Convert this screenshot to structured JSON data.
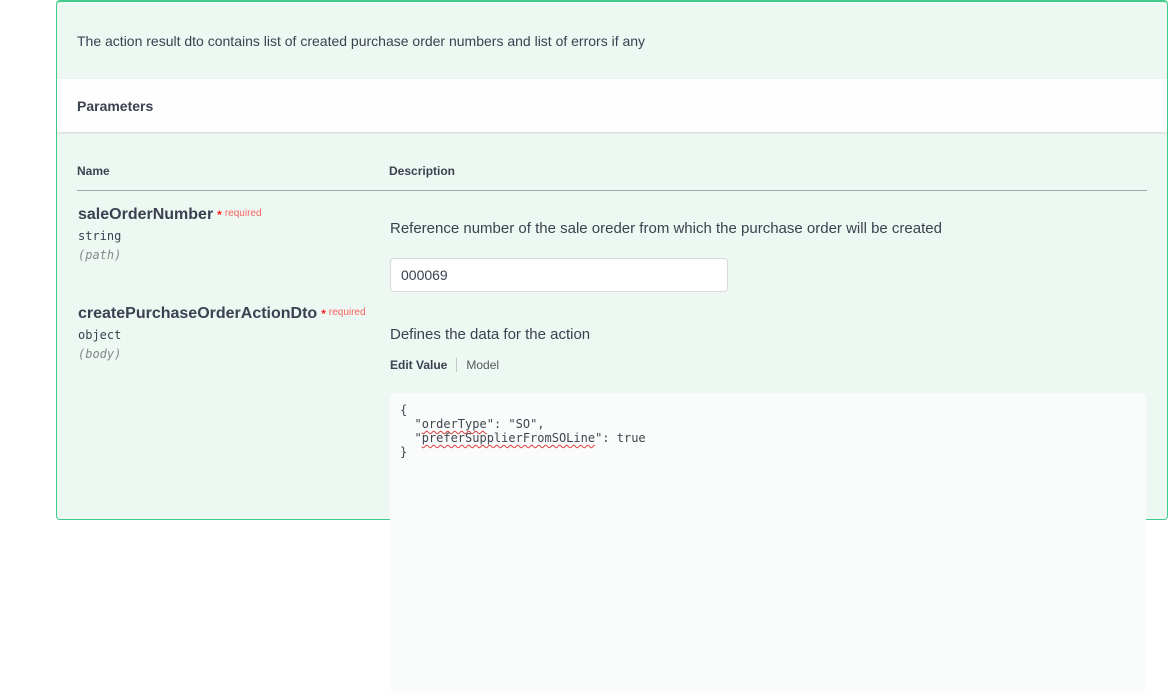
{
  "colors": {
    "accent_green": "#41ca8e",
    "block_background": "#edf8f2",
    "required_red": "#ff2020",
    "text": "#3b4151"
  },
  "opblock": {
    "description": "The action result dto contains list of created purchase order numbers and list of errors if any",
    "parameters_title": "Parameters"
  },
  "table": {
    "name_header": "Name",
    "description_header": "Description"
  },
  "parameters": [
    {
      "name": "saleOrderNumber",
      "required_star": "*",
      "required_label": "required",
      "type": "string",
      "location": "(path)",
      "description": "Reference number of the sale oreder from which the purchase order will be created",
      "value": "000069"
    },
    {
      "name": "createPurchaseOrderActionDto",
      "required_star": "*",
      "required_label": "required",
      "type": "object",
      "location": "(body)",
      "description": "Defines the data for the action",
      "tabs": {
        "edit_value": "Edit Value",
        "model": "Model"
      },
      "body_value": {
        "l1": "{",
        "l2_indent": "  \"",
        "l2_key": "orderType",
        "l2_rest": "\": \"SO\",",
        "l3_indent": "  \"",
        "l3_key": "preferSupplierFromSOLine",
        "l3_rest": "\": true",
        "l4": "}"
      }
    }
  ]
}
